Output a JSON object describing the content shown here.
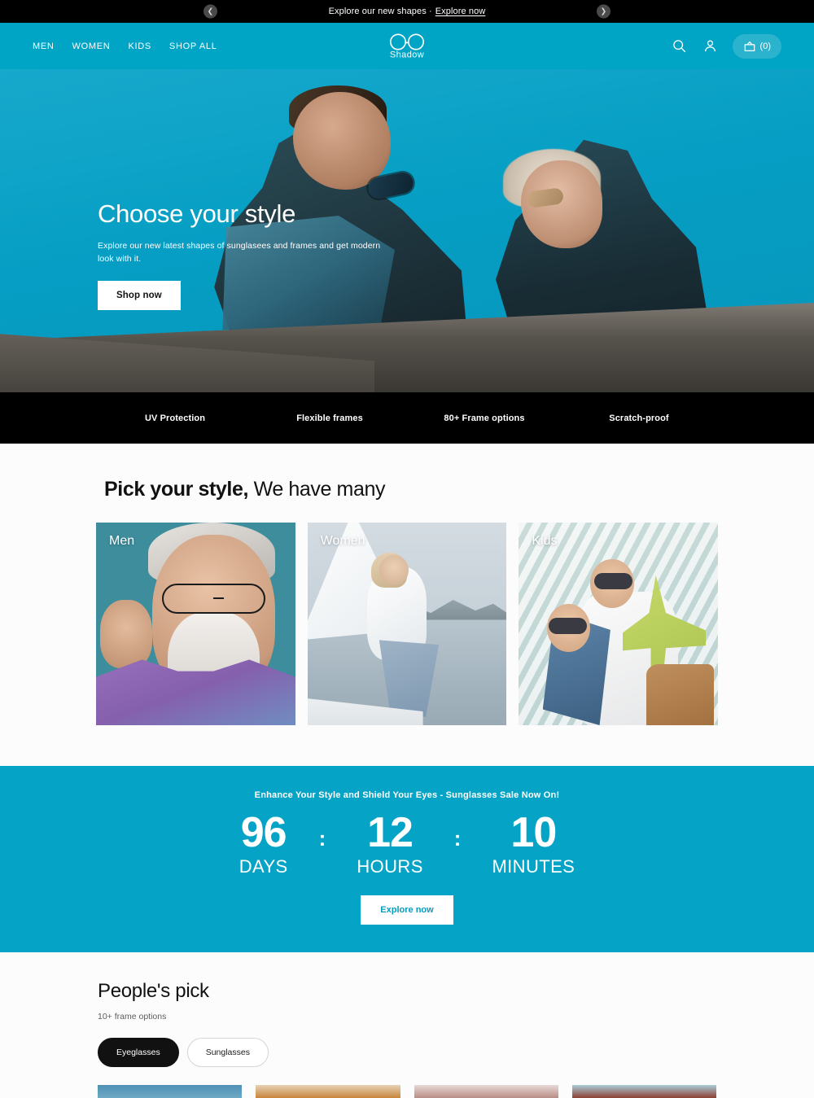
{
  "announcement": {
    "text": "Explore our new shapes ·",
    "link_label": "Explore now",
    "prev_icon": "chevron-left-icon",
    "next_icon": "chevron-right-icon"
  },
  "header": {
    "nav": [
      {
        "label": "MEN"
      },
      {
        "label": "WOMEN"
      },
      {
        "label": "KIDS"
      },
      {
        "label": "SHOP ALL"
      }
    ],
    "logo": {
      "wordmark": "Shadow",
      "icon": "glasses-logo-icon"
    },
    "actions": {
      "search_icon": "search-icon",
      "account_icon": "user-account-icon",
      "cart_icon": "cart-icon",
      "cart_count": "(0)"
    },
    "background_color": "#00a4c5"
  },
  "hero": {
    "title": "Choose your style",
    "subtitle": "Explore our new latest shapes of sunglasees and frames and get modern look with it.",
    "cta_label": "Shop now"
  },
  "features": [
    {
      "label": "UV Protection"
    },
    {
      "label": "Flexible frames"
    },
    {
      "label": "80+ Frame options"
    },
    {
      "label": "Scratch-proof"
    }
  ],
  "pick_section": {
    "title_bold": "Pick your style,",
    "title_regular": " We have many",
    "cards": [
      {
        "label": "Men"
      },
      {
        "label": "Women"
      },
      {
        "label": "Kids"
      }
    ]
  },
  "countdown": {
    "banner": "Enhance Your Style and Shield Your Eyes - Sunglasses Sale Now On!",
    "units": [
      {
        "value": "96",
        "label": "DAYS"
      },
      {
        "value": "12",
        "label": "HOURS"
      },
      {
        "value": "10",
        "label": "MINUTES"
      }
    ],
    "separator": ":",
    "cta_label": "Explore now",
    "background_color": "#05a3c6",
    "cta_text_color": "#0b9cc0"
  },
  "peoples_pick": {
    "title": "People's pick",
    "subtitle": "10+ frame options",
    "tabs": [
      {
        "label": "Eyeglasses",
        "active": true
      },
      {
        "label": "Sunglasses",
        "active": false
      }
    ]
  }
}
